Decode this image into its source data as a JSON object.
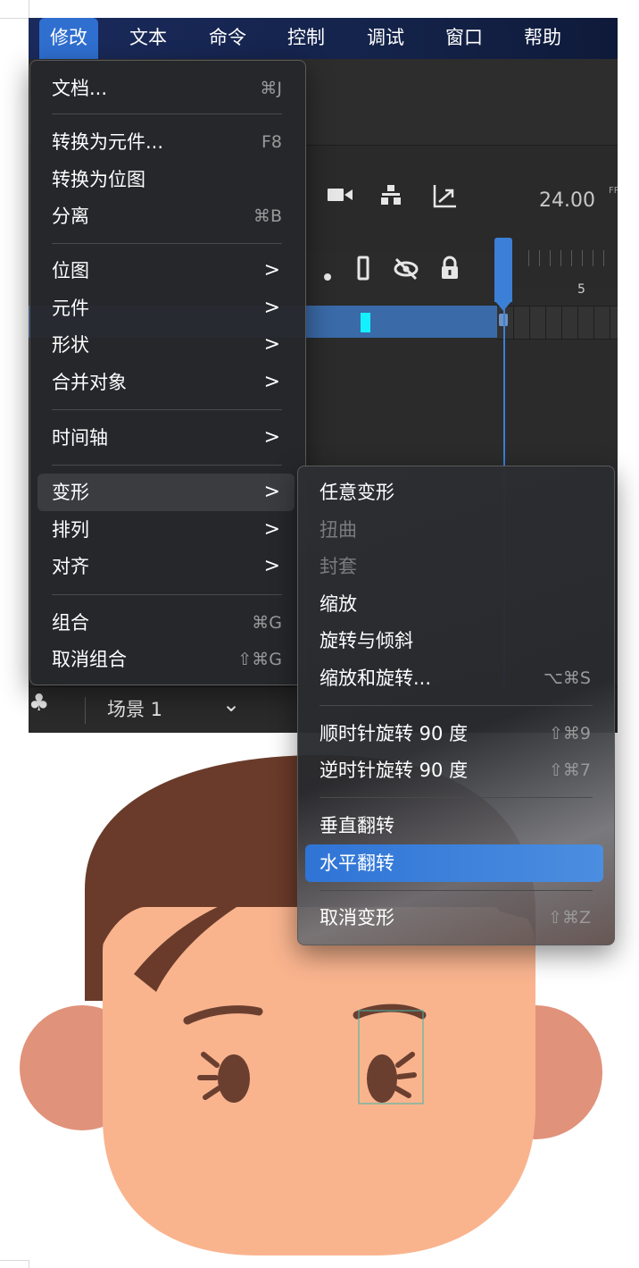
{
  "menubar": {
    "items": [
      {
        "label": "修改"
      },
      {
        "label": "文本"
      },
      {
        "label": "命令"
      },
      {
        "label": "控制"
      },
      {
        "label": "调试"
      },
      {
        "label": "窗口"
      },
      {
        "label": "帮助"
      }
    ]
  },
  "timeline": {
    "fps": "24.00",
    "fps_unit": "FP",
    "frame_label": "5"
  },
  "scene": {
    "label": "场景 1"
  },
  "modify_menu": {
    "items": [
      {
        "label": "文档...",
        "shortcut": "⌘J"
      },
      {
        "label": "转换为元件...",
        "shortcut": "F8"
      },
      {
        "label": "转换为位图",
        "shortcut": ""
      },
      {
        "label": "分离",
        "shortcut": "⌘B"
      },
      {
        "label": "位图"
      },
      {
        "label": "元件"
      },
      {
        "label": "形状"
      },
      {
        "label": "合并对象"
      },
      {
        "label": "时间轴"
      },
      {
        "label": "变形"
      },
      {
        "label": "排列"
      },
      {
        "label": "对齐"
      },
      {
        "label": "组合",
        "shortcut": "⌘G"
      },
      {
        "label": "取消组合",
        "shortcut": "⇧⌘G"
      }
    ]
  },
  "transform_submenu": {
    "items": [
      {
        "label": "任意变形",
        "shortcut": ""
      },
      {
        "label": "扭曲",
        "shortcut": ""
      },
      {
        "label": "封套",
        "shortcut": ""
      },
      {
        "label": "缩放",
        "shortcut": ""
      },
      {
        "label": "旋转与倾斜",
        "shortcut": ""
      },
      {
        "label": "缩放和旋转...",
        "shortcut": "⌥⌘S"
      },
      {
        "label": "顺时针旋转 90 度",
        "shortcut": "⇧⌘9"
      },
      {
        "label": "逆时针旋转 90 度",
        "shortcut": "⇧⌘7"
      },
      {
        "label": "垂直翻转",
        "shortcut": ""
      },
      {
        "label": "水平翻转",
        "shortcut": ""
      },
      {
        "label": "取消变形",
        "shortcut": "⇧⌘Z"
      }
    ]
  },
  "colors": {
    "menu_accent": "#2f74d6",
    "hair": "#6a3b2a",
    "skin": "#f9b48e",
    "ear": "#e1927a",
    "eye": "#6b3f30",
    "layer_swatch": "#15f0ff"
  }
}
